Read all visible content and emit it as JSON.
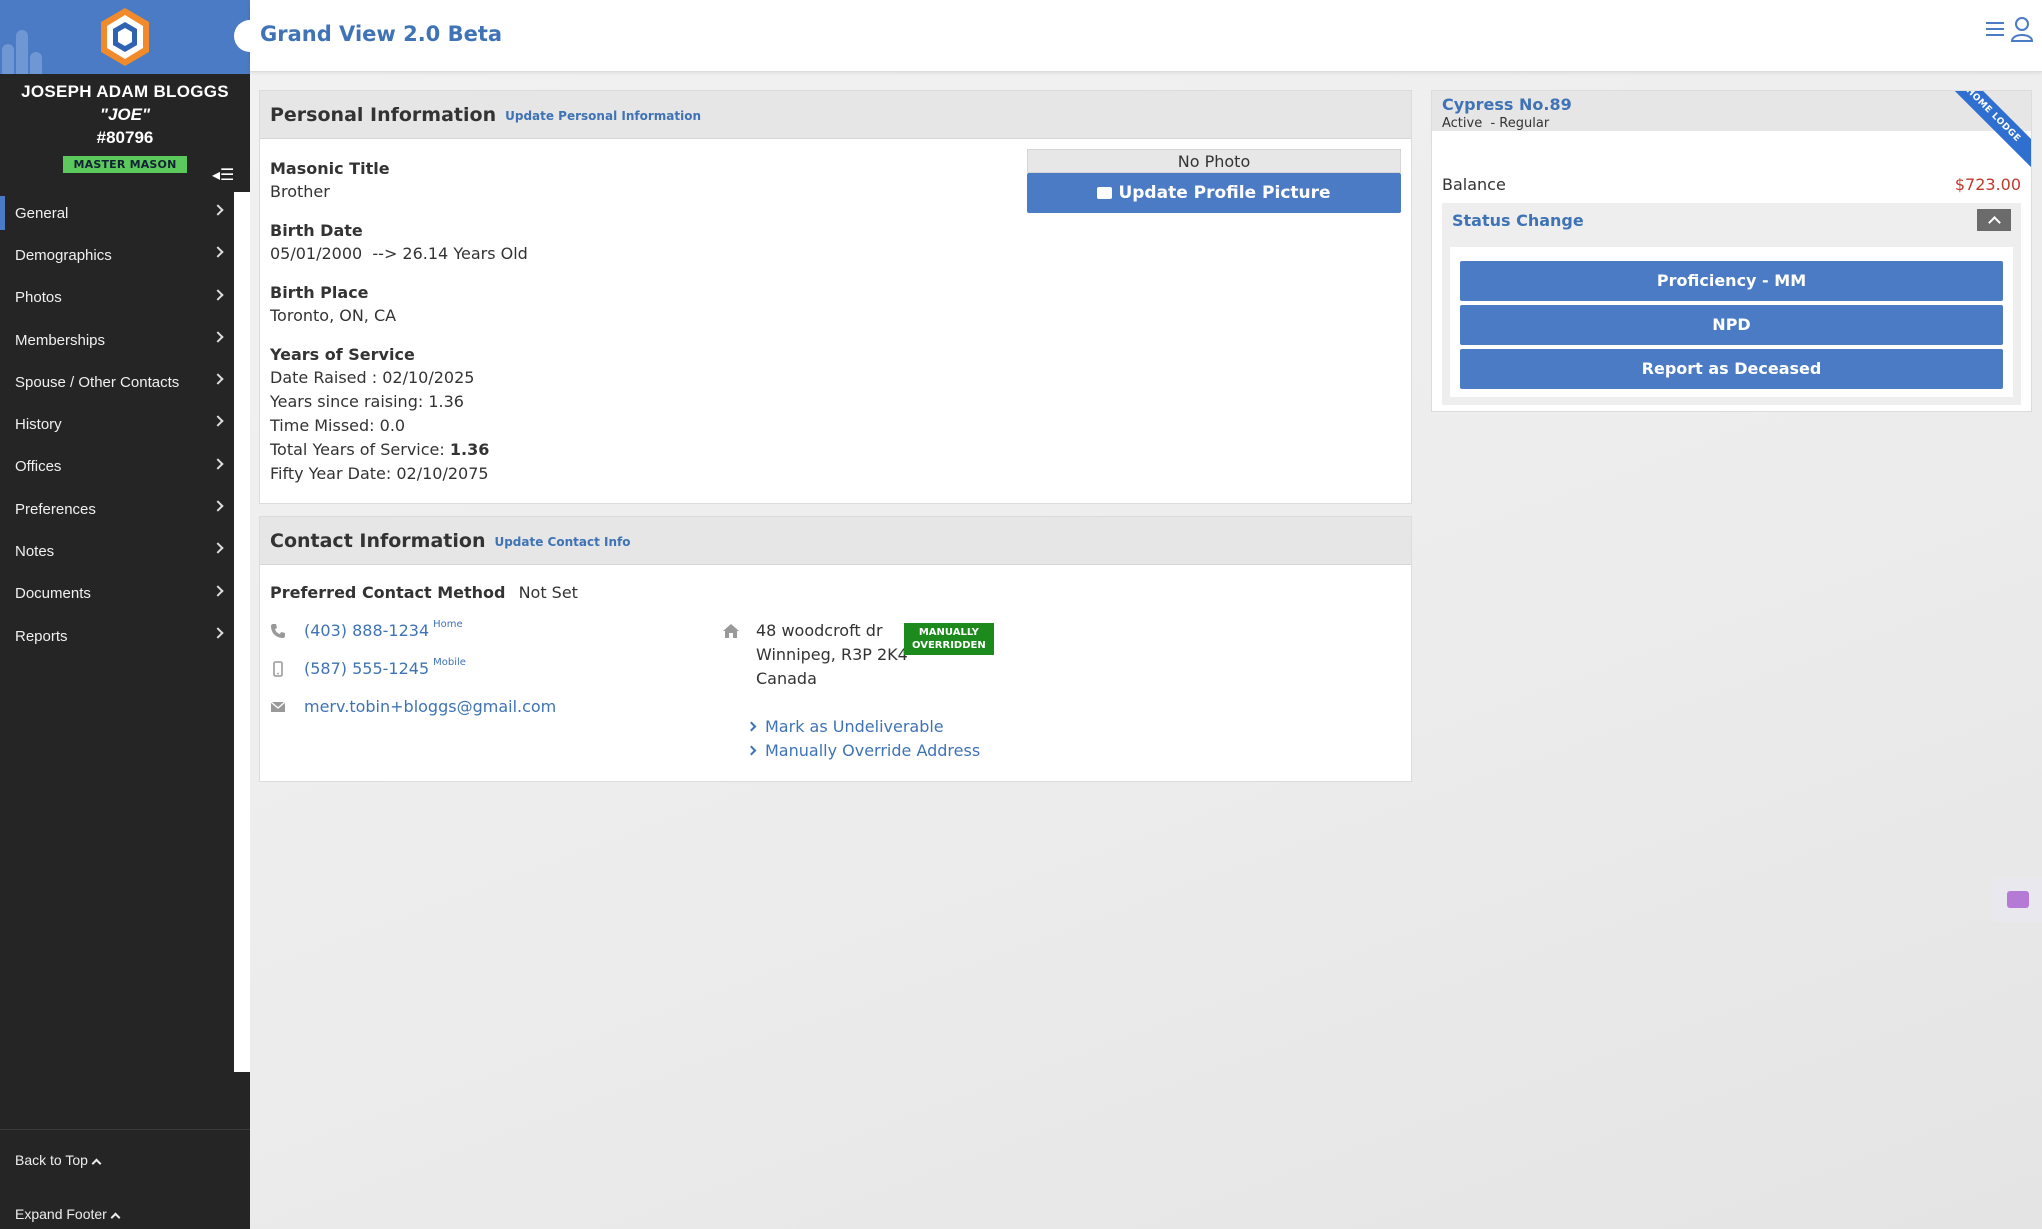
{
  "app": {
    "title": "Grand View 2.0 Beta",
    "colors": {
      "brand": "#4b7bc4",
      "link": "#3f73b5",
      "sidebar": "#252525",
      "badge_green": "#5cc95c",
      "balance_red": "#c0392b"
    }
  },
  "member": {
    "name": "JOSEPH ADAM BLOGGS",
    "nickname": "\"JOE\"",
    "number": "#80796",
    "rank_badge": "MASTER MASON"
  },
  "sidebar": {
    "items": [
      {
        "label": "General"
      },
      {
        "label": "Demographics"
      },
      {
        "label": "Photos"
      },
      {
        "label": "Memberships"
      },
      {
        "label": "Spouse / Other Contacts"
      },
      {
        "label": "History"
      },
      {
        "label": "Offices"
      },
      {
        "label": "Preferences"
      },
      {
        "label": "Notes"
      },
      {
        "label": "Documents"
      },
      {
        "label": "Reports"
      }
    ],
    "back_to_top": "Back to Top",
    "expand_footer": "Expand Footer"
  },
  "personal": {
    "title": "Personal Information",
    "update_link": "Update Personal Information",
    "masonic_title_label": "Masonic Title",
    "masonic_title": "Brother",
    "birth_date_label": "Birth Date",
    "birth_date": "05/01/2000  --> 26.14 Years Old",
    "birth_place_label": "Birth Place",
    "birth_place": "Toronto, ON, CA",
    "years_label": "Years of Service",
    "date_raised": "Date Raised : 02/10/2025",
    "years_since_raising": "Years since raising: 1.36",
    "time_missed": "Time Missed: 0.0",
    "total_years_prefix": "Total Years of Service: ",
    "total_years_value": "1.36",
    "fifty_year": "Fifty Year Date: 02/10/2075",
    "no_photo": "No Photo",
    "update_picture": "Update Profile Picture"
  },
  "contact": {
    "title": "Contact Information",
    "update_link": "Update Contact Info",
    "preferred_label": "Preferred Contact Method",
    "preferred_value": "Not Set",
    "phone_home": "(403) 888-1234",
    "phone_home_tag": "Home",
    "phone_mobile": "(587) 555-1245",
    "phone_mobile_tag": "Mobile",
    "email": "merv.tobin+bloggs@gmail.com",
    "address_line1": "48 woodcroft dr",
    "address_line2": "Winnipeg, R3P 2K4",
    "address_line3": "Canada",
    "override_badge_1": "MANUALLY",
    "override_badge_2": "OVERRIDDEN",
    "mark_undeliverable": "Mark as Undeliverable",
    "manual_override": "Manually Override Address"
  },
  "lodge": {
    "name": "Cypress No.89",
    "status": "Active  - Regular",
    "ribbon": "HOME LODGE",
    "balance_label": "Balance",
    "balance_value": "$723.00",
    "status_change_title": "Status Change",
    "actions": [
      "Proficiency - MM",
      "NPD",
      "Report as Deceased"
    ]
  }
}
